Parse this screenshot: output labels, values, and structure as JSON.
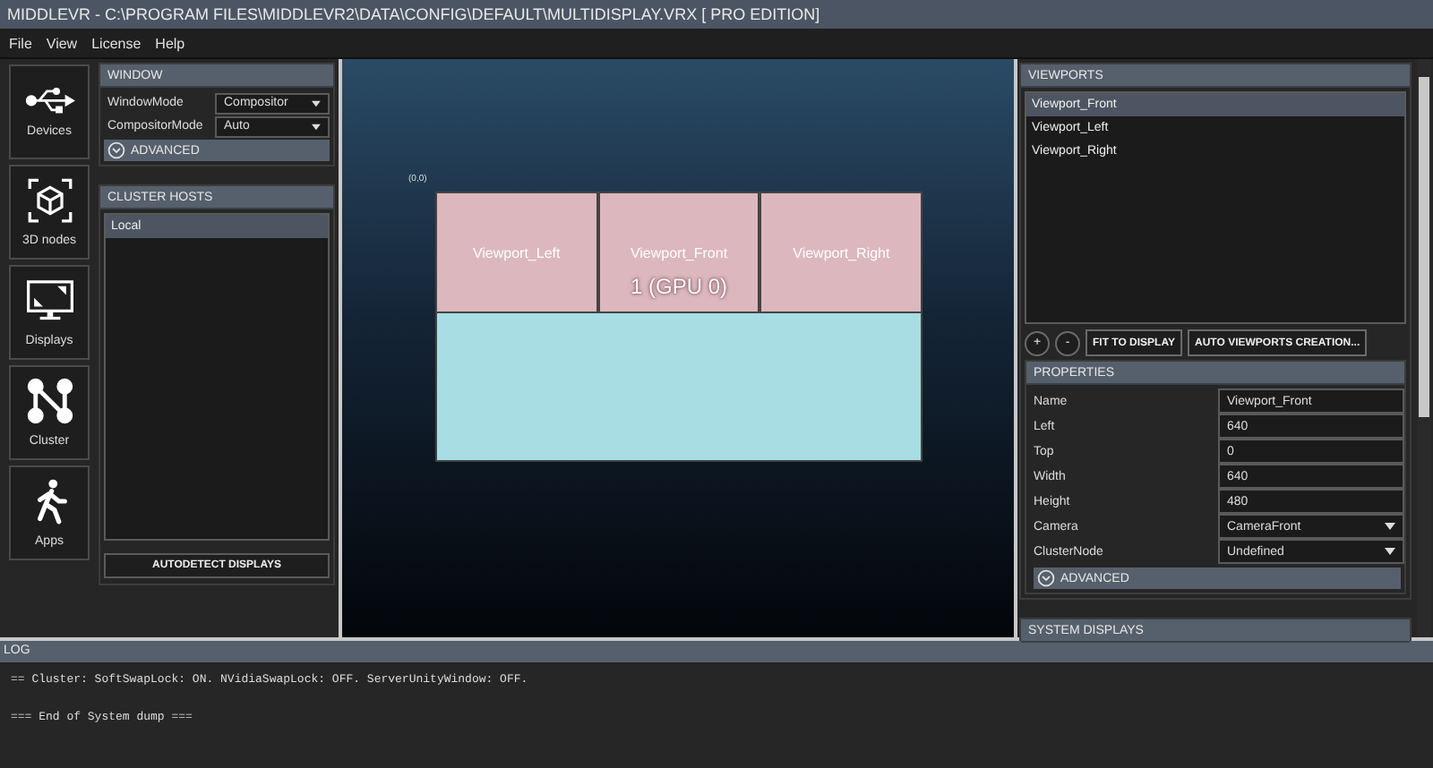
{
  "window": {
    "title": "MIDDLEVR - C:\\PROGRAM FILES\\MIDDLEVR2\\DATA\\CONFIG\\DEFAULT\\MULTIDISPLAY.VRX [ PRO EDITION]"
  },
  "menu": [
    "File",
    "View",
    "License",
    "Help"
  ],
  "nav": [
    {
      "label": "Devices",
      "kind": "usb"
    },
    {
      "label": "3D nodes",
      "kind": "cube"
    },
    {
      "label": "Displays",
      "kind": "monitor"
    },
    {
      "label": "Cluster",
      "kind": "cluster"
    },
    {
      "label": "Apps",
      "kind": "walker"
    }
  ],
  "window_panel": {
    "title": "WINDOW",
    "fields": [
      {
        "label": "WindowMode",
        "value": "Compositor"
      },
      {
        "label": "CompositorMode",
        "value": "Auto"
      }
    ],
    "advanced": "ADVANCED"
  },
  "cluster_hosts": {
    "title": "CLUSTER HOSTS",
    "items": [
      {
        "label": "Local",
        "selected": true
      }
    ],
    "button": "AUTODETECT DISPLAYS"
  },
  "canvas": {
    "origin": "(0,0)",
    "display_label": "1 (GPU 0)",
    "viewports": [
      {
        "label": "Viewport_Left"
      },
      {
        "label": "Viewport_Front"
      },
      {
        "label": "Viewport_Right"
      }
    ]
  },
  "viewports": {
    "title": "VIEWPORTS",
    "items": [
      {
        "label": "Viewport_Front",
        "selected": true
      },
      {
        "label": "Viewport_Left",
        "selected": false
      },
      {
        "label": "Viewport_Right",
        "selected": false
      }
    ],
    "buttons": [
      {
        "label": "+",
        "kind": "round"
      },
      {
        "label": "-",
        "kind": "round"
      },
      {
        "label": "FIT TO DISPLAY",
        "kind": "rect"
      },
      {
        "label": "AUTO VIEWPORTS CREATION...",
        "kind": "rect"
      }
    ]
  },
  "properties": {
    "title": "PROPERTIES",
    "rows": [
      {
        "label": "Name",
        "value": "Viewport_Front",
        "kind": "text"
      },
      {
        "label": "Left",
        "value": "640",
        "kind": "text"
      },
      {
        "label": "Top",
        "value": "0",
        "kind": "text"
      },
      {
        "label": "Width",
        "value": "640",
        "kind": "text"
      },
      {
        "label": "Height",
        "value": "480",
        "kind": "text"
      },
      {
        "label": "Camera",
        "value": "CameraFront",
        "kind": "dropdown"
      },
      {
        "label": "ClusterNode",
        "value": "Undefined",
        "kind": "dropdown"
      }
    ],
    "advanced": "ADVANCED"
  },
  "system_displays": {
    "title": "SYSTEM DISPLAYS"
  },
  "log": {
    "title": "LOG",
    "lines": [
      "== Cluster: SoftSwapLock: ON. NVidiaSwapLock: OFF. ServerUnityWindow: OFF.",
      "=== End of System dump ==="
    ]
  }
}
